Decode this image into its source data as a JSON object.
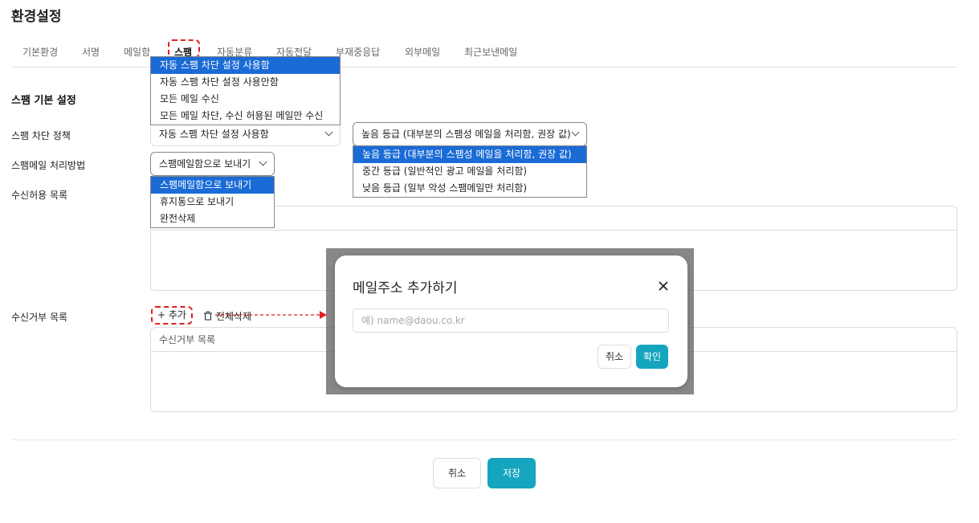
{
  "page": {
    "title": "환경설정"
  },
  "tabs": [
    {
      "label": "기본환경"
    },
    {
      "label": "서명"
    },
    {
      "label": "메일함"
    },
    {
      "label": "스팸",
      "active": true
    },
    {
      "label": "자동분류"
    },
    {
      "label": "자동전달"
    },
    {
      "label": "부재중응답"
    },
    {
      "label": "외부메일"
    },
    {
      "label": "최근보낸메일"
    }
  ],
  "section": {
    "title": "스팸 기본 설정"
  },
  "labels": {
    "policy": "스팸 차단 정책",
    "method": "스팸메일 처리방법",
    "allow_list": "수신허용 목록",
    "block_list": "수신거부 목록"
  },
  "policy_select": {
    "value": "자동 스팸 차단 설정 사용함",
    "options": [
      {
        "label": "자동 스팸 차단 설정 사용함",
        "selected": true
      },
      {
        "label": "자동 스팸 차단 설정 사용안함"
      },
      {
        "label": "모든 메일 수신"
      },
      {
        "label": "모든 메일 차단, 수신 허용된 메일만 수신"
      }
    ]
  },
  "level_select": {
    "value": "높음 등급 (대부분의 스팸성 메일을 처리함, 권장 값)",
    "options": [
      {
        "label": "높음 등급 (대부분의 스팸성 메일을 처리함, 권장 값)",
        "selected": true
      },
      {
        "label": "중간 등급 (일반적인 광고 메일을 처리함)"
      },
      {
        "label": "낮음 등급 (일부 악성 스팸메일만 처리함)"
      }
    ]
  },
  "method_select": {
    "value": "스팸메일함으로 보내기",
    "options": [
      {
        "label": "스팸메일함으로 보내기",
        "selected": true
      },
      {
        "label": "휴지통으로 보내기"
      },
      {
        "label": "완전삭제"
      }
    ]
  },
  "block_list": {
    "add_label": "+ 추가",
    "delete_all_label": "전체삭제",
    "header": "수신거부 목록"
  },
  "modal": {
    "title": "메일주소 추가하기",
    "placeholder": "예) name@daou.co.kr",
    "cancel_label": "취소",
    "ok_label": "확인"
  },
  "footer": {
    "cancel_label": "취소",
    "save_label": "저장"
  },
  "colors": {
    "accent": "#16a5bf",
    "highlight": "#e02020",
    "selected_option": "#1b6bd6"
  }
}
